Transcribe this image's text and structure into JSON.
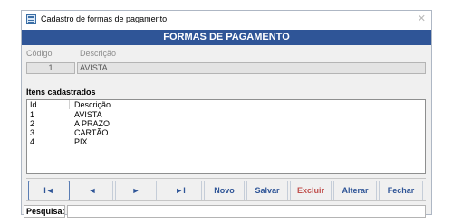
{
  "window": {
    "title": "Cadastro de formas de pagamento",
    "close_glyph": "✕"
  },
  "header": {
    "title": "FORMAS DE PAGAMENTO"
  },
  "form": {
    "codigo_label": "Código",
    "descricao_label": "Descrição",
    "codigo_value": "1",
    "descricao_value": "AVISTA"
  },
  "list": {
    "section_title": "Itens cadastrados",
    "columns": [
      "Id",
      "Descrição"
    ],
    "rows": [
      {
        "id": "1",
        "descricao": "AVISTA"
      },
      {
        "id": "2",
        "descricao": "A PRAZO"
      },
      {
        "id": "3",
        "descricao": "CARTÃO"
      },
      {
        "id": "4",
        "descricao": "PIX"
      }
    ]
  },
  "nav": {
    "first": "I◄",
    "prev": "◄",
    "next": "►",
    "last": "►I",
    "novo": "Novo",
    "salvar": "Salvar",
    "excluir": "Excluir",
    "alterar": "Alterar",
    "fechar": "Fechar"
  },
  "search": {
    "label": "Pesquisa:",
    "value": ""
  },
  "colors": {
    "header_band": "#2f5597",
    "button_text": "#2f5597",
    "excluir_text": "#c0504d"
  },
  "icons": {
    "app": "form-window-icon",
    "close": "close-icon"
  }
}
